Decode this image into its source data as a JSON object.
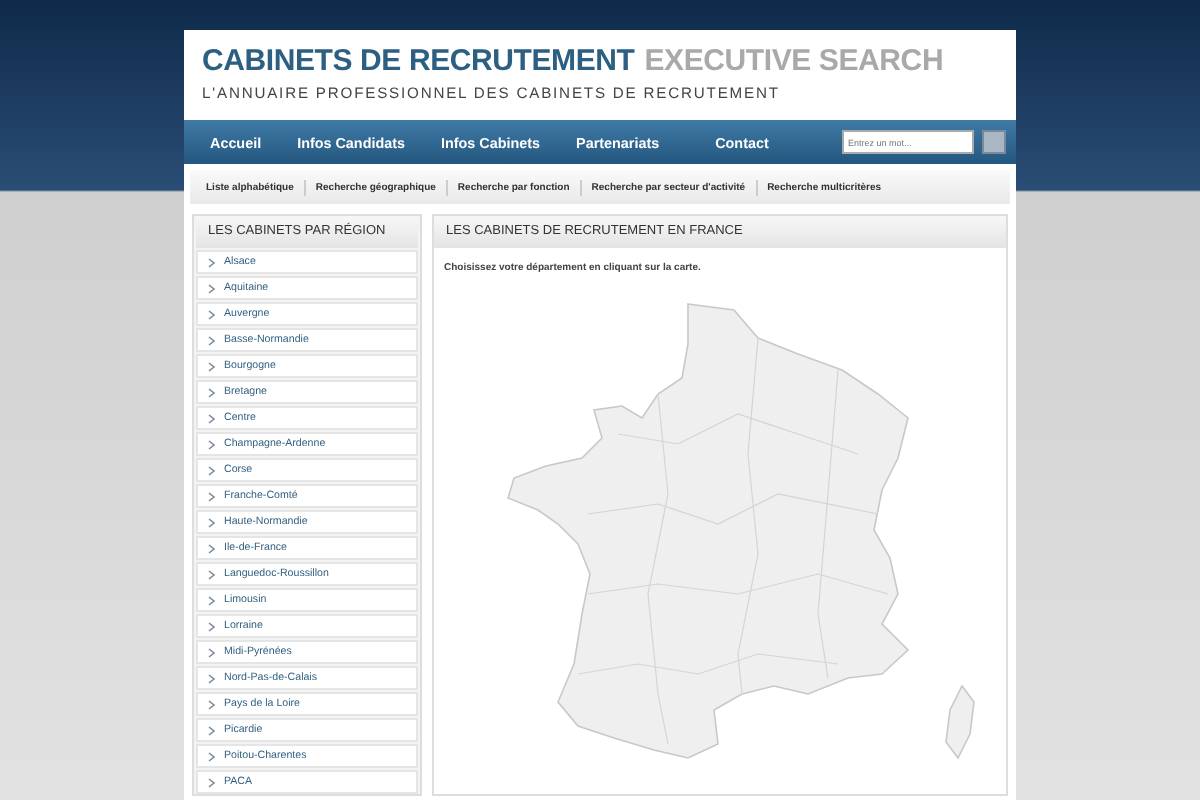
{
  "header": {
    "title": "CABINETS DE RECRUTEMENT",
    "title_accent": "EXECUTIVE SEARCH",
    "tagline": "L'ANNUAIRE PROFESSIONNEL DES CABINETS DE RECRUTEMENT"
  },
  "nav": {
    "items": [
      {
        "label": "Accueil"
      },
      {
        "label": "Infos Candidats"
      },
      {
        "label": "Infos Cabinets"
      },
      {
        "label": "Partenariats"
      },
      {
        "label": "Contact"
      }
    ],
    "search": {
      "placeholder": "Entrez un mot..."
    }
  },
  "subnav": [
    "Liste alphabétique",
    "Recherche géographique",
    "Recherche par fonction",
    "Recherche par secteur d'activité",
    "Recherche multicritères"
  ],
  "sidebar": {
    "title": "LES CABINETS PAR RÉGION",
    "items": [
      "Alsace",
      "Aquitaine",
      "Auvergne",
      "Basse-Normandie",
      "Bourgogne",
      "Bretagne",
      "Centre",
      "Champagne-Ardenne",
      "Corse",
      "Franche-Comté",
      "Haute-Normandie",
      "Ile-de-France",
      "Languedoc-Roussillon",
      "Limousin",
      "Lorraine",
      "Midi-Pyrénées",
      "Nord-Pas-de-Calais",
      "Pays de la Loire",
      "Picardie",
      "Poitou-Charentes",
      "PACA"
    ]
  },
  "main": {
    "title": "LES CABINETS DE RECRUTEMENT EN FRANCE",
    "instruction": "Choisissez votre département en cliquant sur la carte."
  }
}
